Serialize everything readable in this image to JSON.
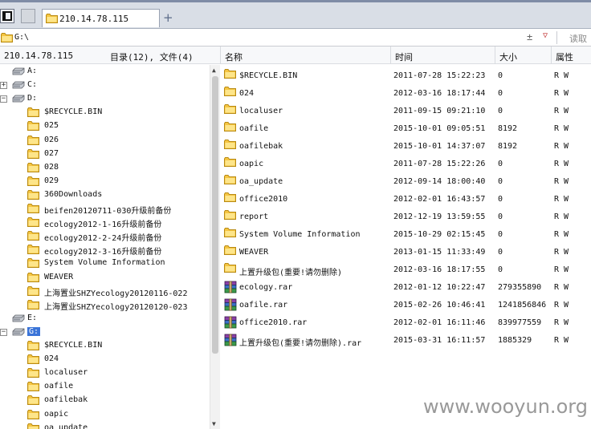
{
  "tabbar": {
    "tab_title": "210.14.78.115",
    "add_glyph": "+"
  },
  "address": {
    "path": "G:\\",
    "plus_glyph": "±",
    "dropdown_glyph": "▽",
    "read_label": "读取"
  },
  "header": {
    "host": "210.14.78.115",
    "counts": "目录(12), 文件(4)",
    "col_name": "名称",
    "col_time": "时间",
    "col_size": "大小",
    "col_attr": "属性"
  },
  "tree": [
    {
      "label": "A:",
      "kind": "drive",
      "expander": "",
      "selected": false
    },
    {
      "label": "C:",
      "kind": "drive",
      "expander": "+",
      "selected": false
    },
    {
      "label": "D:",
      "kind": "drive",
      "expander": "−",
      "selected": false
    },
    {
      "label": "$RECYCLE.BIN",
      "kind": "folder"
    },
    {
      "label": "025",
      "kind": "folder"
    },
    {
      "label": "026",
      "kind": "folder"
    },
    {
      "label": "027",
      "kind": "folder"
    },
    {
      "label": "028",
      "kind": "folder"
    },
    {
      "label": "029",
      "kind": "folder"
    },
    {
      "label": "360Downloads",
      "kind": "folder"
    },
    {
      "label": "beifen20120711-030升级前备份",
      "kind": "folder"
    },
    {
      "label": "ecology2012-1-16升级前备份",
      "kind": "folder"
    },
    {
      "label": "ecology2012-2-24升级前备份",
      "kind": "folder"
    },
    {
      "label": "ecology2012-3-16升级前备份",
      "kind": "folder"
    },
    {
      "label": "System Volume Information",
      "kind": "folder"
    },
    {
      "label": "WEAVER",
      "kind": "folder"
    },
    {
      "label": "上海置业SHZYecology20120116-022",
      "kind": "folder"
    },
    {
      "label": "上海置业SHZYecology20120120-023",
      "kind": "folder"
    },
    {
      "label": "E:",
      "kind": "drive",
      "expander": "",
      "selected": false
    },
    {
      "label": "G:",
      "kind": "drive",
      "expander": "−",
      "selected": true
    },
    {
      "label": "$RECYCLE.BIN",
      "kind": "folder"
    },
    {
      "label": "024",
      "kind": "folder"
    },
    {
      "label": "localuser",
      "kind": "folder"
    },
    {
      "label": "oafile",
      "kind": "folder"
    },
    {
      "label": "oafilebak",
      "kind": "folder"
    },
    {
      "label": "oapic",
      "kind": "folder"
    },
    {
      "label": "oa_update",
      "kind": "folder"
    }
  ],
  "files": [
    {
      "name": "$RECYCLE.BIN",
      "time": "2011-07-28 15:22:23",
      "size": "0",
      "attr": "R W",
      "icon": "folder-icon"
    },
    {
      "name": "024",
      "time": "2012-03-16 18:17:44",
      "size": "0",
      "attr": "R W",
      "icon": "folder-icon"
    },
    {
      "name": "localuser",
      "time": "2011-09-15 09:21:10",
      "size": "0",
      "attr": "R W",
      "icon": "folder-icon"
    },
    {
      "name": "oafile",
      "time": "2015-10-01 09:05:51",
      "size": "8192",
      "attr": "R W",
      "icon": "folder-icon"
    },
    {
      "name": "oafilebak",
      "time": "2015-10-01 14:37:07",
      "size": "8192",
      "attr": "R W",
      "icon": "folder-icon"
    },
    {
      "name": "oapic",
      "time": "2011-07-28 15:22:26",
      "size": "0",
      "attr": "R W",
      "icon": "folder-icon"
    },
    {
      "name": "oa_update",
      "time": "2012-09-14 18:00:40",
      "size": "0",
      "attr": "R W",
      "icon": "folder-icon"
    },
    {
      "name": "office2010",
      "time": "2012-02-01 16:43:57",
      "size": "0",
      "attr": "R W",
      "icon": "folder-icon"
    },
    {
      "name": "report",
      "time": "2012-12-19 13:59:55",
      "size": "0",
      "attr": "R W",
      "icon": "folder-icon"
    },
    {
      "name": "System Volume Information",
      "time": "2015-10-29 02:15:45",
      "size": "0",
      "attr": "R W",
      "icon": "folder-icon"
    },
    {
      "name": "WEAVER",
      "time": "2013-01-15 11:33:49",
      "size": "0",
      "attr": "R W",
      "icon": "folder-icon"
    },
    {
      "name": "上置升级包(重要!请勿删除)",
      "time": "2012-03-16 18:17:55",
      "size": "0",
      "attr": "R W",
      "icon": "folder-icon"
    },
    {
      "name": "ecology.rar",
      "time": "2012-01-12 10:22:47",
      "size": "279355890",
      "attr": "R W",
      "icon": "rar-icon"
    },
    {
      "name": "oafile.rar",
      "time": "2015-02-26 10:46:41",
      "size": "1241856846",
      "attr": "R W",
      "icon": "rar-icon"
    },
    {
      "name": "office2010.rar",
      "time": "2012-02-01 16:11:46",
      "size": "839977559",
      "attr": "R W",
      "icon": "rar-icon"
    },
    {
      "name": "上置升级包(重要!请勿删除).rar",
      "time": "2015-03-31 16:11:57",
      "size": "1885329",
      "attr": "R W",
      "icon": "rar-icon"
    }
  ],
  "watermark": "www.wooyun.org",
  "colors": {
    "folder": "#f5c542",
    "selection": "#3a74d8",
    "tabbar": "#d9dee6"
  }
}
